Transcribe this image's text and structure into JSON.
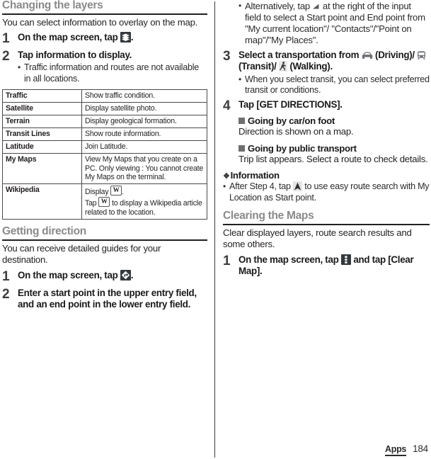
{
  "left_column": {
    "section1": {
      "heading": "Changing the layers",
      "intro": "You can select information to overlay on the map.",
      "step1": {
        "number": "1",
        "text_before": "On the map screen, tap",
        "icon": "layers-icon",
        "text_after": "."
      },
      "step2": {
        "number": "2",
        "title": "Tap information to display.",
        "bullet": "Traffic information and routes are not available in all locations."
      },
      "table": {
        "rows": [
          {
            "name": "Traffic",
            "desc": "Show traffic condition."
          },
          {
            "name": "Satellite",
            "desc": "Display satellite photo."
          },
          {
            "name": "Terrain",
            "desc": "Display geological formation."
          },
          {
            "name": "Transit Lines",
            "desc": "Show route information."
          },
          {
            "name": "Latitude",
            "desc": "Join Latitude."
          },
          {
            "name": "My Maps",
            "desc": "View My Maps that you create on a PC. Only viewing : You cannot create My Maps on the terminal."
          }
        ],
        "wikipedia_row": {
          "name": "Wikipedia",
          "line1_before": "Display",
          "line1_after": ".",
          "line2_before": "Tap",
          "line2_after": "to display a Wikipedia article related to the location.",
          "icon": "wikipedia-w-icon"
        }
      }
    },
    "section2": {
      "heading": "Getting direction",
      "intro": "You can receive detailed guides for your destination.",
      "step1": {
        "number": "1",
        "text_before": "On the map screen, tap",
        "icon": "directions-icon",
        "text_after": "."
      },
      "step2": {
        "number": "2",
        "title": "Enter a start point in the upper entry field, and an end point in the lower entry field."
      }
    }
  },
  "right_column": {
    "top_bullet": {
      "text_before": "Alternatively, tap",
      "icon": "dropdown-triangle-icon",
      "text_after": "at the right of the input field to select a Start point and End point from \"My current location\"/ \"Contacts\"/\"Point on map\"/\"My Places\"."
    },
    "step3": {
      "number": "3",
      "title_part1": "Select a transportation from",
      "car_icon": "car-icon",
      "title_part2": "(Driving)/",
      "bus_icon": "bus-icon",
      "title_part3": "(Transit)/",
      "walk_icon": "walking-icon",
      "title_part4": "(Walking).",
      "bullet": "When you select transit, you can select preferred transit or conditions."
    },
    "step4": {
      "number": "4",
      "title": "Tap [GET DIRECTIONS].",
      "sub1_heading": "Going by car/on foot",
      "sub1_text": "Direction is shown on a map.",
      "sub2_heading": "Going by public transport",
      "sub2_text": "Trip list appears. Select a route to check details."
    },
    "information": {
      "heading": "Information",
      "bullet_before": "After Step 4, tap",
      "icon": "navigation-arrow-icon",
      "bullet_after": "to use easy route search with My Location as Start point."
    },
    "section_clearing": {
      "heading": "Clearing the Maps",
      "intro": "Clear displayed layers, route search results and some others.",
      "step1": {
        "number": "1",
        "text_before": "On the map screen, tap",
        "icon": "overflow-menu-icon",
        "text_mid": "and tap [Clear Map]."
      }
    }
  },
  "footer": {
    "tab_label": "Apps",
    "page_number": "184"
  },
  "colors": {
    "heading_gray": "#8a8a8a",
    "text_dark": "#231f20",
    "icon_dark_bg": "#35393d",
    "square_marker": "#6e6e6e"
  }
}
